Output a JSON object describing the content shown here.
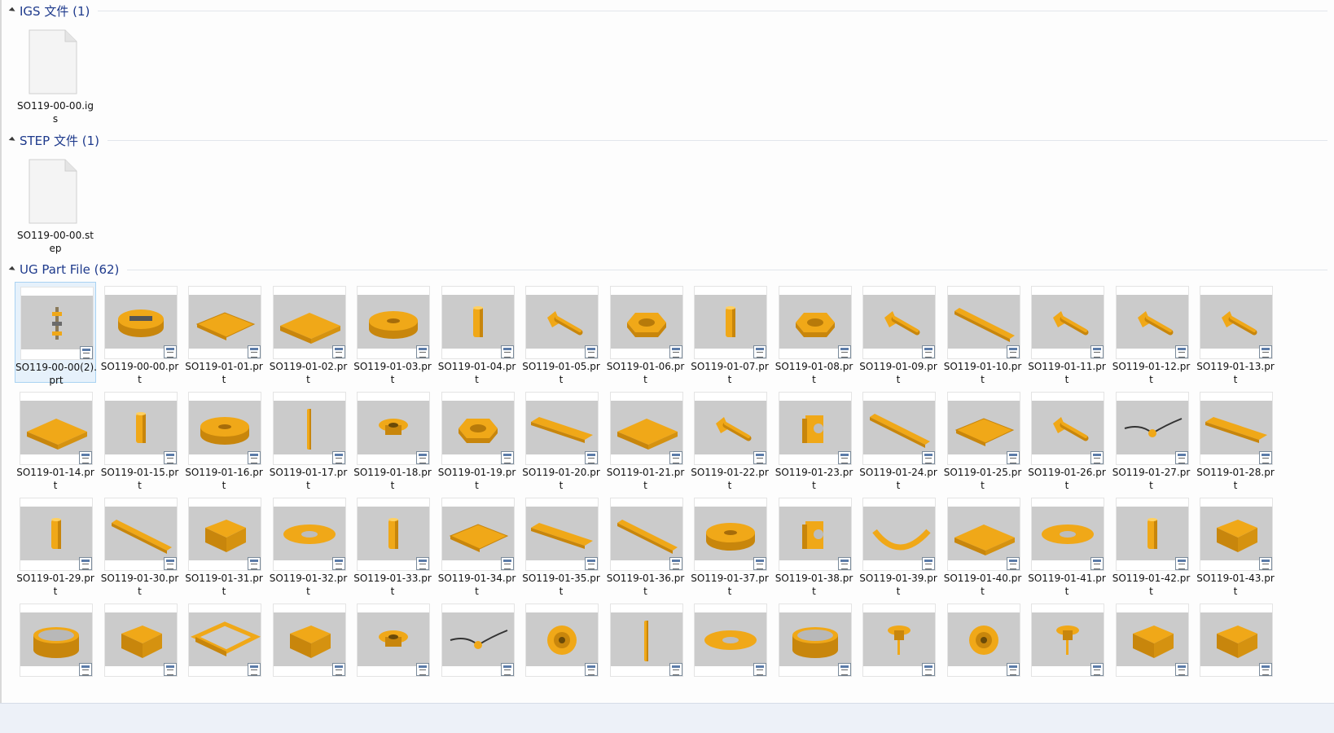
{
  "groups": [
    {
      "title": "IGS 文件 (1)",
      "files": [
        {
          "name": "SO119-00-00.igs"
        }
      ]
    },
    {
      "title": "STEP 文件 (1)",
      "files": [
        {
          "name": "SO119-00-00.step"
        }
      ]
    },
    {
      "title": "UG Part File (62)",
      "files": [
        {
          "name": "SO119-00-00(2).prt",
          "shape": "assembly"
        },
        {
          "name": "SO119-00-00.prt",
          "shape": "drum"
        },
        {
          "name": "SO119-01-01.prt",
          "shape": "grid-plate"
        },
        {
          "name": "SO119-01-02.prt",
          "shape": "plate"
        },
        {
          "name": "SO119-01-03.prt",
          "shape": "flange"
        },
        {
          "name": "SO119-01-04.prt",
          "shape": "standoff"
        },
        {
          "name": "SO119-01-05.prt",
          "shape": "bolt"
        },
        {
          "name": "SO119-01-06.prt",
          "shape": "nut"
        },
        {
          "name": "SO119-01-07.prt",
          "shape": "standoff"
        },
        {
          "name": "SO119-01-08.prt",
          "shape": "nut"
        },
        {
          "name": "SO119-01-09.prt",
          "shape": "bolt"
        },
        {
          "name": "SO119-01-10.prt",
          "shape": "bar"
        },
        {
          "name": "SO119-01-11.prt",
          "shape": "bolt"
        },
        {
          "name": "SO119-01-12.prt",
          "shape": "bolt"
        },
        {
          "name": "SO119-01-13.prt",
          "shape": "bolt"
        },
        {
          "name": "SO119-01-14.prt",
          "shape": "plate"
        },
        {
          "name": "SO119-01-15.prt",
          "shape": "standoff"
        },
        {
          "name": "SO119-01-16.prt",
          "shape": "flange"
        },
        {
          "name": "SO119-01-17.prt",
          "shape": "pin"
        },
        {
          "name": "SO119-01-18.prt",
          "shape": "gear"
        },
        {
          "name": "SO119-01-19.prt",
          "shape": "nut"
        },
        {
          "name": "SO119-01-20.prt",
          "shape": "strip"
        },
        {
          "name": "SO119-01-21.prt",
          "shape": "plate"
        },
        {
          "name": "SO119-01-22.prt",
          "shape": "bolt"
        },
        {
          "name": "SO119-01-23.prt",
          "shape": "bracket"
        },
        {
          "name": "SO119-01-24.prt",
          "shape": "bar"
        },
        {
          "name": "SO119-01-25.prt",
          "shape": "grid-plate"
        },
        {
          "name": "SO119-01-26.prt",
          "shape": "bolt"
        },
        {
          "name": "SO119-01-27.prt",
          "shape": "wire"
        },
        {
          "name": "SO119-01-28.prt",
          "shape": "strip"
        },
        {
          "name": "SO119-01-29.prt",
          "shape": "standoff"
        },
        {
          "name": "SO119-01-30.prt",
          "shape": "bar"
        },
        {
          "name": "SO119-01-31.prt",
          "shape": "block"
        },
        {
          "name": "SO119-01-32.prt",
          "shape": "disc"
        },
        {
          "name": "SO119-01-33.prt",
          "shape": "standoff"
        },
        {
          "name": "SO119-01-34.prt",
          "shape": "grid-plate"
        },
        {
          "name": "SO119-01-35.prt",
          "shape": "strip"
        },
        {
          "name": "SO119-01-36.prt",
          "shape": "bar"
        },
        {
          "name": "SO119-01-37.prt",
          "shape": "flange"
        },
        {
          "name": "SO119-01-38.prt",
          "shape": "bracket"
        },
        {
          "name": "SO119-01-39.prt",
          "shape": "arc"
        },
        {
          "name": "SO119-01-40.prt",
          "shape": "plate"
        },
        {
          "name": "SO119-01-41.prt",
          "shape": "disc"
        },
        {
          "name": "SO119-01-42.prt",
          "shape": "standoff"
        },
        {
          "name": "SO119-01-43.prt",
          "shape": "block"
        },
        {
          "name": "",
          "shape": "ring"
        },
        {
          "name": "",
          "shape": "block"
        },
        {
          "name": "",
          "shape": "frame"
        },
        {
          "name": "",
          "shape": "block"
        },
        {
          "name": "",
          "shape": "gear"
        },
        {
          "name": "",
          "shape": "wire"
        },
        {
          "name": "",
          "shape": "bearing"
        },
        {
          "name": "",
          "shape": "pin"
        },
        {
          "name": "",
          "shape": "disc"
        },
        {
          "name": "",
          "shape": "ring"
        },
        {
          "name": "",
          "shape": "knob"
        },
        {
          "name": "",
          "shape": "bearing"
        },
        {
          "name": "",
          "shape": "knob"
        },
        {
          "name": "",
          "shape": "block"
        },
        {
          "name": "",
          "shape": "block"
        }
      ]
    }
  ],
  "colors": {
    "part": "#f0a818",
    "part_dark": "#c8860c",
    "thumb_bg": "#cbcbcb",
    "header_text": "#1e3a8c"
  }
}
